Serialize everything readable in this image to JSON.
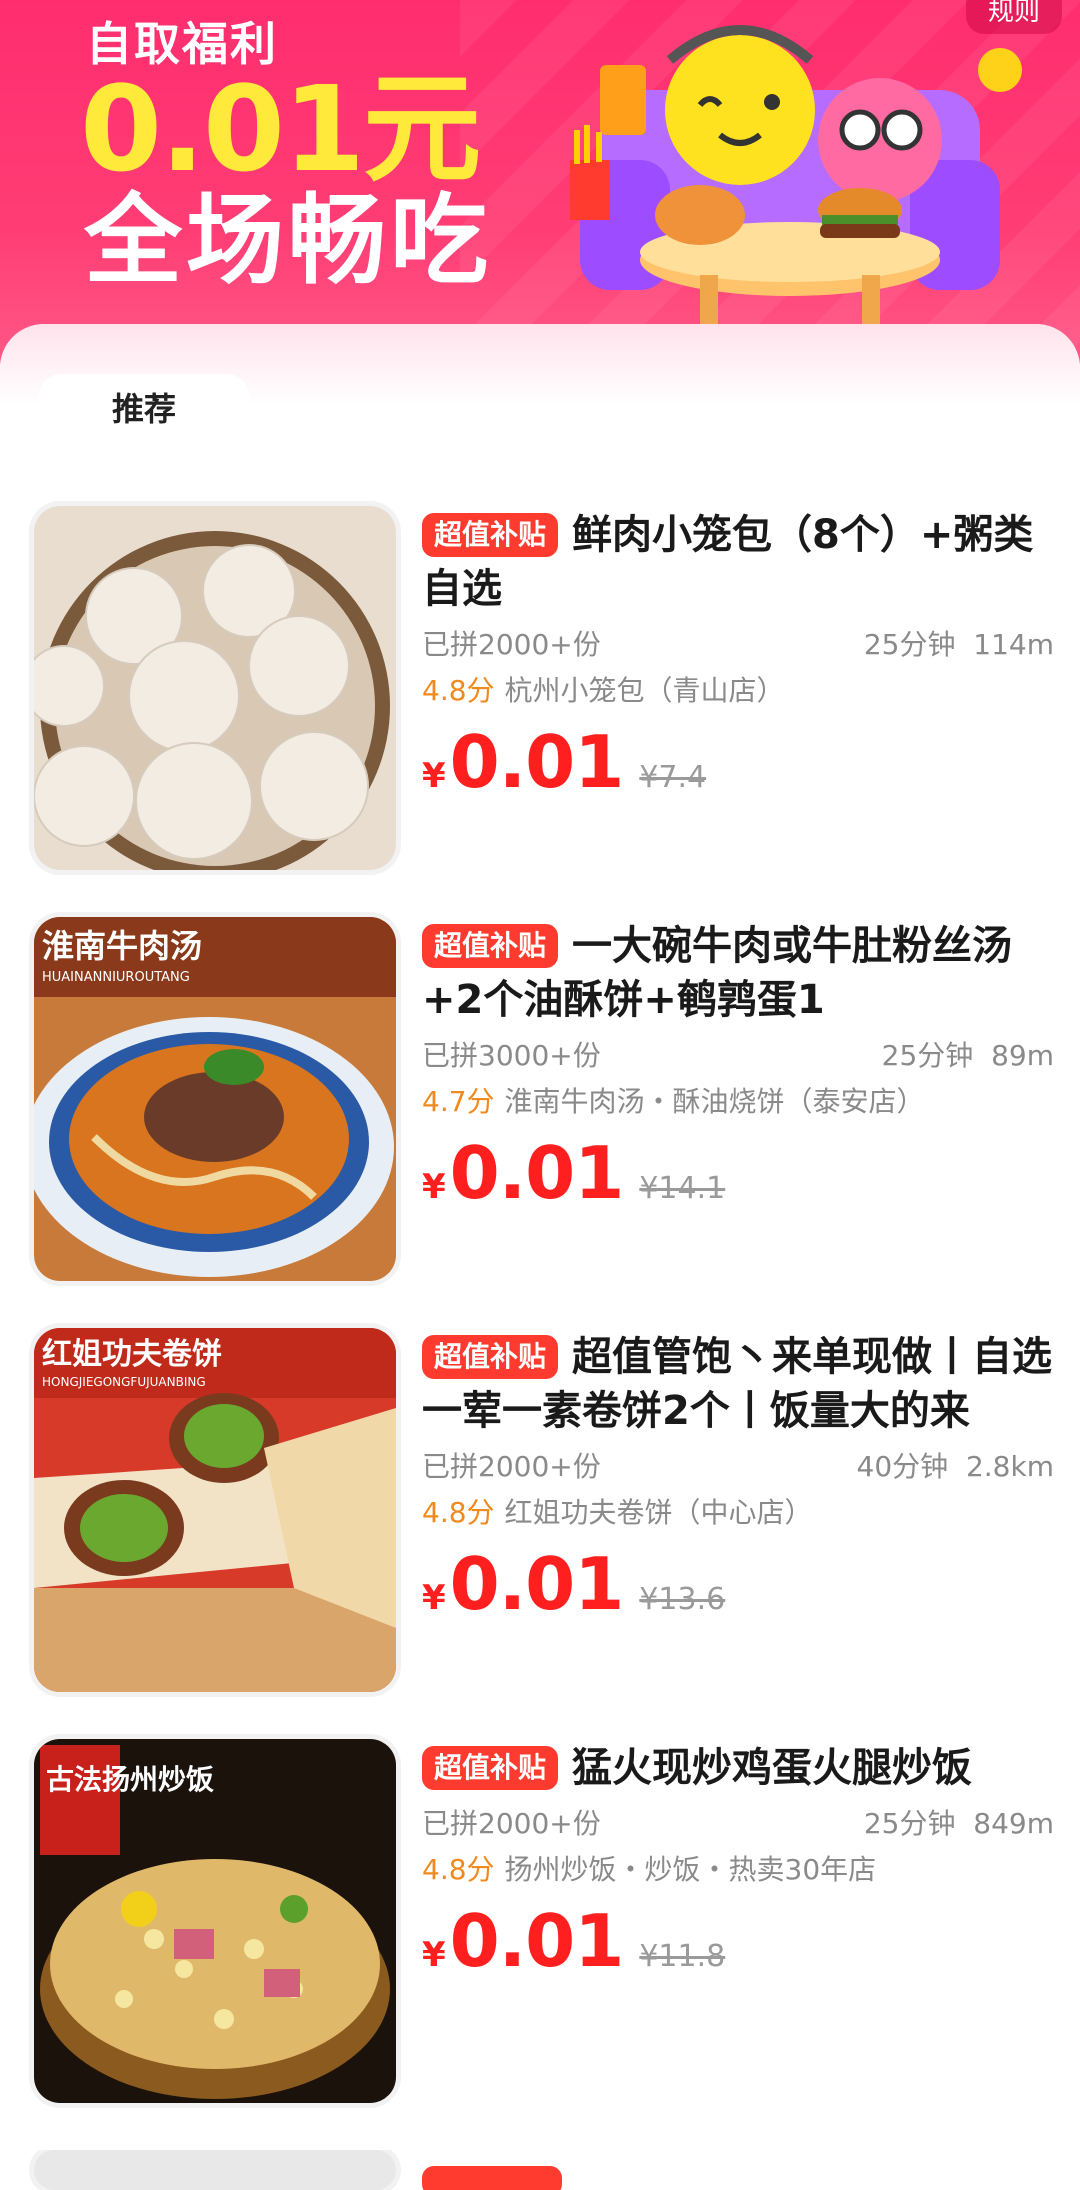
{
  "banner": {
    "title": "自取福利",
    "price": "0.01元",
    "subtitle": "全场畅吃",
    "rules": "规则"
  },
  "tabs": {
    "active": "推荐"
  },
  "items": [
    {
      "tag": "超值补贴",
      "title": "鲜肉小笼包（8个）+粥类自选",
      "sold": "已拼2000+份",
      "time": "25分钟",
      "distance": "114m",
      "score": "4.8分",
      "shop": "杭州小笼包（青山店）",
      "yen": "¥",
      "price": "0.01",
      "original": "¥7.4"
    },
    {
      "tag": "超值补贴",
      "title": "一大碗牛肉或牛肚粉丝汤+2个油酥饼+鹌鹑蛋1",
      "sold": "已拼3000+份",
      "time": "25分钟",
      "distance": "89m",
      "score": "4.7分",
      "shop": "淮南牛肉汤・酥油烧饼（泰安店）",
      "yen": "¥",
      "price": "0.01",
      "original": "¥14.1",
      "image_text": "淮南牛肉汤",
      "image_subtext": "HUAINANNIUROUTANG"
    },
    {
      "tag": "超值补贴",
      "title": "超值管饱丶来单现做丨自选一荤一素卷饼2个丨饭量大的来",
      "sold": "已拼2000+份",
      "time": "40分钟",
      "distance": "2.8km",
      "score": "4.8分",
      "shop": "红姐功夫卷饼（中心店）",
      "yen": "¥",
      "price": "0.01",
      "original": "¥13.6",
      "image_text": "红姐功夫卷饼",
      "image_subtext": "HONGJIEGONGFUJUANBING"
    },
    {
      "tag": "超值补贴",
      "title": "猛火现炒鸡蛋火腿炒饭",
      "sold": "已拼2000+份",
      "time": "25分钟",
      "distance": "849m",
      "score": "4.8分",
      "shop": "扬州炒饭・炒饭・热卖30年店",
      "yen": "¥",
      "price": "0.01",
      "original": "¥11.8",
      "image_text": "古法扬州炒饭"
    }
  ],
  "colors": {
    "banner": "#ff2d6f",
    "price_yellow": "#ffe93b",
    "tag": "#ff3b2f",
    "price": "#ff1f1f",
    "score": "#f08a1c"
  }
}
